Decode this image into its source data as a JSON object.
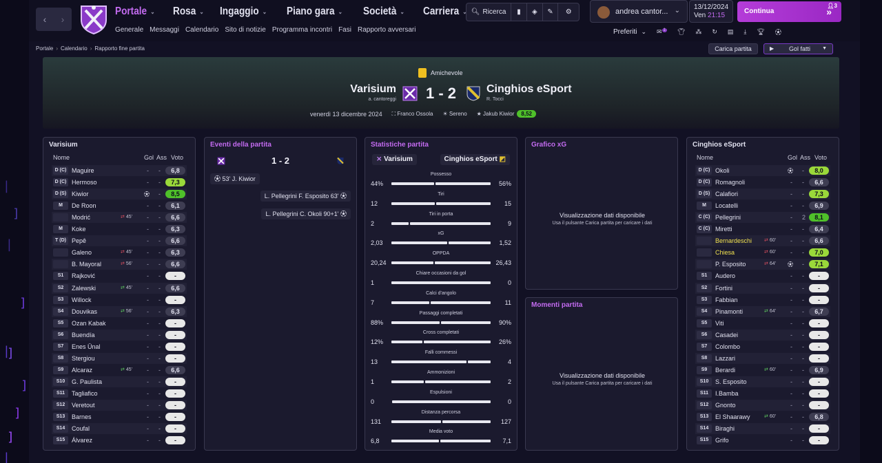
{
  "nav": {
    "back": "‹",
    "forward": "›"
  },
  "menu": [
    {
      "label": "Portale",
      "active": true
    },
    {
      "label": "Rosa"
    },
    {
      "label": "Ingaggio"
    },
    {
      "label": "Piano gara"
    },
    {
      "label": "Società"
    },
    {
      "label": "Carriera"
    }
  ],
  "submenu": [
    "Generale",
    "Messaggi",
    "Calendario",
    "Sito di notizie",
    "Programma incontri",
    "Fasi",
    "Rapporto avversari"
  ],
  "tools": {
    "search_label": "Ricerca"
  },
  "user": {
    "name": "andrea cantor..."
  },
  "date": {
    "day": "13/12/2024",
    "weekday": "Ven",
    "time": "21:15"
  },
  "continue": {
    "label": "Continua",
    "badge": "3"
  },
  "favorites": {
    "label": "Preferiti",
    "badge": "1"
  },
  "breadcrumb": [
    "Portale",
    "Calendario",
    "Rapporto fine partita"
  ],
  "buttons": {
    "load_match": "Carica partita",
    "goals": "Gol fatti"
  },
  "match": {
    "competition": "Amichevole",
    "home": {
      "name": "Varisium",
      "manager": "a. cantoreggi"
    },
    "away": {
      "name": "Cinghios eSport",
      "manager": "R. Tocci"
    },
    "score": "1 - 2",
    "date": "venerdì 13 dicembre 2024",
    "referee": "Franco Ossola",
    "weather": "Sereno",
    "motm": "Jakub Kiwior",
    "motm_rating": "8,52"
  },
  "home_panel": {
    "title": "Varisium",
    "headers": {
      "name": "Nome",
      "goals": "Gol",
      "assists": "Ass",
      "rating": "Voto"
    },
    "players": [
      {
        "pos": "D (C)",
        "name": "Maguire",
        "gol": "-",
        "ass": "-",
        "rating": "6,8",
        "rc": ""
      },
      {
        "pos": "D (C)",
        "name": "Hermoso",
        "gol": "-",
        "ass": "-",
        "rating": "7,3",
        "rc": "g"
      },
      {
        "pos": "D (S)",
        "name": "Kiwior",
        "gol": "",
        "ass": "-",
        "rating": "8,5",
        "rc": "g2",
        "icon": "⚽"
      },
      {
        "pos": "M",
        "name": "De Roon",
        "gol": "-",
        "ass": "-",
        "rating": "6,1",
        "rc": ""
      },
      {
        "pos": "",
        "name": "Modrić",
        "sub": "45'",
        "subtype": "out",
        "gol": "-",
        "ass": "-",
        "rating": "6,6",
        "rc": ""
      },
      {
        "pos": "M",
        "name": "Koke",
        "gol": "-",
        "ass": "-",
        "rating": "6,3",
        "rc": ""
      },
      {
        "pos": "T (D)",
        "name": "Pepê",
        "gol": "-",
        "ass": "-",
        "rating": "6,6",
        "rc": ""
      },
      {
        "pos": "",
        "name": "Galeno",
        "sub": "45'",
        "subtype": "out",
        "gol": "-",
        "ass": "-",
        "rating": "6,3",
        "rc": ""
      },
      {
        "pos": "",
        "name": "B. Mayoral",
        "sub": "56'",
        "subtype": "out",
        "gol": "-",
        "ass": "-",
        "rating": "6,6",
        "rc": ""
      },
      {
        "pos": "S1",
        "name": "Rajković",
        "gol": "-",
        "ass": "-",
        "rating": "-",
        "rc": "d"
      },
      {
        "pos": "S2",
        "name": "Zalewski",
        "sub": "45'",
        "subtype": "in",
        "gol": "-",
        "ass": "-",
        "rating": "6,6",
        "rc": ""
      },
      {
        "pos": "S3",
        "name": "Willock",
        "gol": "-",
        "ass": "-",
        "rating": "-",
        "rc": "d"
      },
      {
        "pos": "S4",
        "name": "Douvikas",
        "sub": "56'",
        "subtype": "in",
        "gol": "-",
        "ass": "-",
        "rating": "6,3",
        "rc": ""
      },
      {
        "pos": "S5",
        "name": "Ozan Kabak",
        "gol": "-",
        "ass": "-",
        "rating": "-",
        "rc": "d"
      },
      {
        "pos": "S6",
        "name": "Buendía",
        "gol": "-",
        "ass": "-",
        "rating": "-",
        "rc": "d"
      },
      {
        "pos": "S7",
        "name": "Enes Ünal",
        "gol": "-",
        "ass": "-",
        "rating": "-",
        "rc": "d"
      },
      {
        "pos": "S8",
        "name": "Stergiou",
        "gol": "-",
        "ass": "-",
        "rating": "-",
        "rc": "d"
      },
      {
        "pos": "S9",
        "name": "Alcaraz",
        "sub": "45'",
        "subtype": "in",
        "gol": "-",
        "ass": "-",
        "rating": "6,6",
        "rc": ""
      },
      {
        "pos": "S10",
        "name": "G. Paulista",
        "gol": "-",
        "ass": "-",
        "rating": "-",
        "rc": "d"
      },
      {
        "pos": "S11",
        "name": "Tagliafico",
        "gol": "-",
        "ass": "-",
        "rating": "-",
        "rc": "d"
      },
      {
        "pos": "S12",
        "name": "Veretout",
        "gol": "-",
        "ass": "-",
        "rating": "-",
        "rc": "d"
      },
      {
        "pos": "S13",
        "name": "Barnes",
        "gol": "-",
        "ass": "-",
        "rating": "-",
        "rc": "d"
      },
      {
        "pos": "S14",
        "name": "Coufal",
        "gol": "-",
        "ass": "-",
        "rating": "-",
        "rc": "d"
      },
      {
        "pos": "S15",
        "name": "Álvarez",
        "gol": "-",
        "ass": "-",
        "rating": "-",
        "rc": "d"
      }
    ]
  },
  "events_panel": {
    "title": "Eventi della partita",
    "score": "1 - 2",
    "events": [
      {
        "side": "home",
        "text": "53' J. Kiwior"
      },
      {
        "side": "away",
        "text": "L. Pellegrini F. Esposito 63'"
      },
      {
        "side": "away",
        "text": "L. Pellegrini C. Okoli 90+1'"
      }
    ]
  },
  "stats_panel": {
    "title": "Statistiche partita",
    "home": "Varisium",
    "away": "Cinghios eSport",
    "stats": [
      {
        "label": "Possesso",
        "h": "44%",
        "a": "56%",
        "hp": 0.44
      },
      {
        "label": "Tiri",
        "h": "12",
        "a": "15",
        "hp": 0.444
      },
      {
        "label": "Tiri in porta",
        "h": "2",
        "a": "9",
        "hp": 0.182
      },
      {
        "label": "xG",
        "h": "2,03",
        "a": "1,52",
        "hp": 0.572
      },
      {
        "label": "OPPDA",
        "h": "20,24",
        "a": "26,43",
        "hp": 0.434
      },
      {
        "label": "Chiare occasioni da gol",
        "h": "1",
        "a": "0",
        "hp": 1.0
      },
      {
        "label": "Calci d'angolo",
        "h": "7",
        "a": "11",
        "hp": 0.389
      },
      {
        "label": "Passaggi completati",
        "h": "88%",
        "a": "90%",
        "hp": 0.494
      },
      {
        "label": "Cross completati",
        "h": "12%",
        "a": "26%",
        "hp": 0.316
      },
      {
        "label": "Falli commessi",
        "h": "13",
        "a": "4",
        "hp": 0.765
      },
      {
        "label": "Ammonizioni",
        "h": "1",
        "a": "2",
        "hp": 0.333
      },
      {
        "label": "Espulsioni",
        "h": "0",
        "a": "0",
        "hp": 0.0
      },
      {
        "label": "Distanza percorsa",
        "h": "131",
        "a": "127",
        "hp": 0.508
      },
      {
        "label": "Media voto",
        "h": "6,8",
        "a": "7,1",
        "hp": 0.489
      }
    ]
  },
  "xg_panel": {
    "title": "Grafico xG",
    "msg": "Visualizzazione dati disponibile",
    "sub": "Usa il pulsante Carica partita per caricare i dati"
  },
  "moments_panel": {
    "title": "Momenti partita",
    "msg": "Visualizzazione dati disponibile",
    "sub": "Usa il pulsante Carica partita per caricare i dati"
  },
  "away_panel": {
    "title": "Cinghios eSport",
    "headers": {
      "name": "Nome",
      "goals": "Gol",
      "assists": "Ass",
      "rating": "Voto"
    },
    "players": [
      {
        "pos": "D (C)",
        "name": "Okoli",
        "gol": "",
        "ass": "-",
        "rating": "8,0",
        "rc": "g",
        "icon": "⚽"
      },
      {
        "pos": "D (C)",
        "name": "Romagnoli",
        "gol": "-",
        "ass": "-",
        "rating": "6,6",
        "rc": ""
      },
      {
        "pos": "D (S)",
        "name": "Calafiori",
        "gol": "-",
        "ass": "-",
        "rating": "7,3",
        "rc": "g"
      },
      {
        "pos": "M",
        "name": "Locatelli",
        "gol": "-",
        "ass": "-",
        "rating": "6,9",
        "rc": ""
      },
      {
        "pos": "C (C)",
        "name": "Pellegrini",
        "gol": "-",
        "ass": "2",
        "rating": "8,1",
        "rc": "g2"
      },
      {
        "pos": "C (C)",
        "name": "Miretti",
        "gol": "-",
        "ass": "-",
        "rating": "6,4",
        "rc": ""
      },
      {
        "pos": "",
        "name": "Bernardeschi",
        "yellow": true,
        "sub": "60'",
        "subtype": "out",
        "gol": "-",
        "ass": "-",
        "rating": "6,6",
        "rc": ""
      },
      {
        "pos": "",
        "name": "Chiesa",
        "yellow": true,
        "sub": "60'",
        "subtype": "out",
        "gol": "-",
        "ass": "-",
        "rating": "7,0",
        "rc": "g"
      },
      {
        "pos": "",
        "name": "P. Esposito",
        "sub": "64'",
        "subtype": "out",
        "gol": "",
        "ass": "-",
        "rating": "7,1",
        "rc": "g",
        "icon": "⚽"
      },
      {
        "pos": "S1",
        "name": "Audero",
        "gol": "-",
        "ass": "-",
        "rating": "-",
        "rc": "d"
      },
      {
        "pos": "S2",
        "name": "Fortini",
        "gol": "-",
        "ass": "-",
        "rating": "-",
        "rc": "d"
      },
      {
        "pos": "S3",
        "name": "Fabbian",
        "gol": "-",
        "ass": "-",
        "rating": "-",
        "rc": "d"
      },
      {
        "pos": "S4",
        "name": "Pinamonti",
        "sub": "64'",
        "subtype": "in",
        "gol": "-",
        "ass": "-",
        "rating": "6,7",
        "rc": ""
      },
      {
        "pos": "S5",
        "name": "Viti",
        "gol": "-",
        "ass": "-",
        "rating": "-",
        "rc": "d"
      },
      {
        "pos": "S6",
        "name": "Casadei",
        "gol": "-",
        "ass": "-",
        "rating": "-",
        "rc": "d"
      },
      {
        "pos": "S7",
        "name": "Colombo",
        "gol": "-",
        "ass": "-",
        "rating": "-",
        "rc": "d"
      },
      {
        "pos": "S8",
        "name": "Lazzari",
        "gol": "-",
        "ass": "-",
        "rating": "-",
        "rc": "d"
      },
      {
        "pos": "S9",
        "name": "Berardi",
        "sub": "60'",
        "subtype": "in",
        "gol": "-",
        "ass": "-",
        "rating": "6,9",
        "rc": ""
      },
      {
        "pos": "S10",
        "name": "S. Esposito",
        "gol": "-",
        "ass": "-",
        "rating": "-",
        "rc": "d"
      },
      {
        "pos": "S11",
        "name": "I.Bamba",
        "gol": "-",
        "ass": "-",
        "rating": "-",
        "rc": "d"
      },
      {
        "pos": "S12",
        "name": "Gnonto",
        "gol": "-",
        "ass": "-",
        "rating": "-",
        "rc": "d"
      },
      {
        "pos": "S13",
        "name": "El Shaarawy",
        "sub": "60'",
        "subtype": "in",
        "gol": "-",
        "ass": "-",
        "rating": "6,8",
        "rc": ""
      },
      {
        "pos": "S14",
        "name": "Biraghi",
        "gol": "-",
        "ass": "-",
        "rating": "-",
        "rc": "d"
      },
      {
        "pos": "S15",
        "name": "Grifo",
        "gol": "-",
        "ass": "-",
        "rating": "-",
        "rc": "d"
      }
    ]
  },
  "colors": {
    "accent": "#c36bf0",
    "rating_high": "#4fc02a",
    "rating_good": "#9ad83a"
  }
}
